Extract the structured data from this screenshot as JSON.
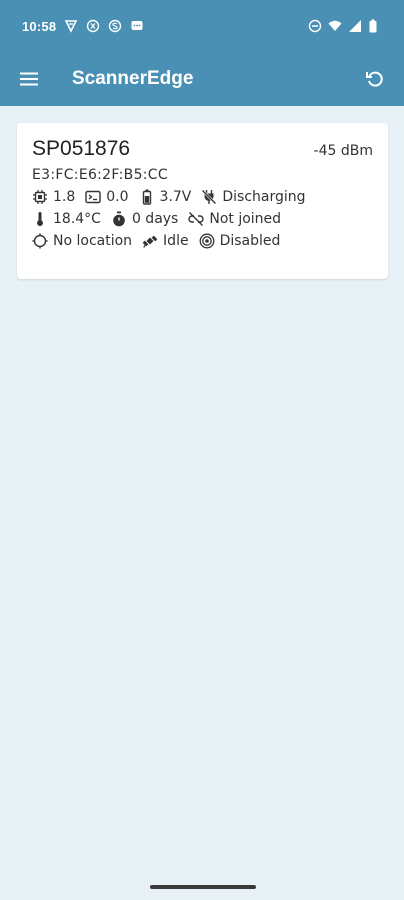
{
  "status_bar": {
    "time": "10:58"
  },
  "app_bar": {
    "title": "ScannerEdge"
  },
  "device": {
    "name": "SP051876",
    "rssi": "-45 dBm",
    "mac": "E3:FC:E6:2F:B5:CC",
    "firmware": "1.8",
    "hardware": "0.0",
    "battery_voltage": "3.7V",
    "charging_state": "Discharging",
    "temperature": "18.4°C",
    "uptime": "0 days",
    "network": "Not joined",
    "location": "No location",
    "motion": "Idle",
    "mode": "Disabled"
  },
  "colors": {
    "primary": "#4a90b4",
    "background": "#e8f2f6",
    "card": "#ffffff"
  }
}
